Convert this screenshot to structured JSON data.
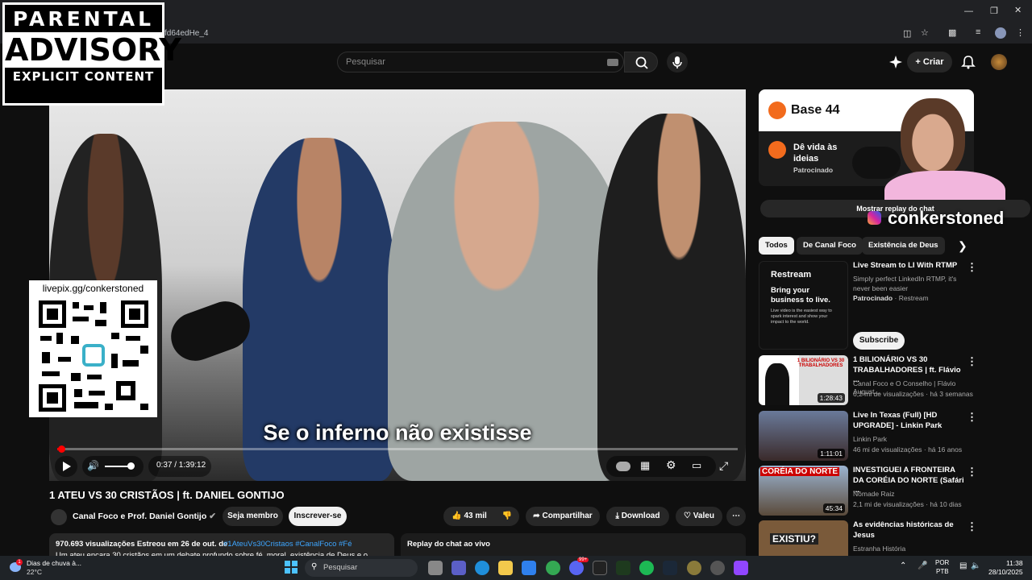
{
  "browser": {
    "url_fragment": "fd64edHe_4",
    "window_controls": [
      "minimize-icon",
      "restore-icon",
      "close-icon"
    ]
  },
  "youtube": {
    "search_placeholder": "Pesquisar",
    "create_label": "Criar",
    "video": {
      "subtitle": "Se o inferno não existisse",
      "time": "0:37 / 1:39:12",
      "progress_fraction": 0.006,
      "title": "1 ATEU VS 30 CRISTÃOS | ft. DANIEL GONTIJO",
      "channel": "Canal Foco e Prof. Daniel Gontijo",
      "member_label": "Seja membro",
      "subscribe_label": "Inscrever-se",
      "likes": "43 mil",
      "share_label": "Compartilhar",
      "download_label": "Download",
      "thanks_label": "Valeu",
      "views": "970.693 visualizações  Estreou em 26 de out. de",
      "tags": "#1AteuVs30Cristaos #CanalFoco #Fé",
      "description_line": "Um ateu encara 30 cristãos em um debate profundo sobre fé, moral, existência de Deus e o...",
      "replay_chat": "Replay do chat ao vivo"
    },
    "sidebar_ad": {
      "brand": "Base 44",
      "line1": "Dê vida às",
      "line2": "ideias",
      "sponsored": "Patrocinado"
    },
    "show_chat": "Mostrar replay do chat",
    "chips": [
      "Todos",
      "De Canal Foco",
      "Existência de Deus"
    ],
    "ad2": {
      "title": "Live Stream to LI With RTMP",
      "desc": "Simply perfect LinkedIn RTMP, it's never been easier",
      "sponsor": "Patrocinado",
      "advertiser": "Restream",
      "subscribe": "Subscribe",
      "thumb_brand": "Restream",
      "thumb_headline": "Bring your business to live.",
      "thumb_body": "Live video is the easiest way to spark interest and show your impact to the world."
    },
    "recommendations": [
      {
        "title": "1 BILIONÁRIO VS 30 TRABALHADORES | ft. Flávio ...",
        "channel": "Canal Foco e O Conselho | Flávio August...",
        "meta": "6,2 mi de visualizações · há 3 semanas",
        "duration": "1:28:43",
        "thumb_text": "1 BILIONÁRIO VS 30 TRABALHADORES"
      },
      {
        "title": "Live In Texas (Full) [HD UPGRADE] - Linkin Park",
        "channel": "Linkin Park",
        "meta": "46 mi de visualizações · há 16 anos",
        "duration": "1:11:01",
        "thumb_text": ""
      },
      {
        "title": "INVESTIGUEI A FRONTEIRA DA CORÉIA DO NORTE (Safári ...",
        "channel": "Nômade Raiz",
        "meta": "2,1 mi de visualizações · há 10 dias",
        "duration": "45:34",
        "thumb_text": "CORÉIA DO NORTE"
      },
      {
        "title": "As evidências históricas de Jesus",
        "channel": "Estranha História",
        "meta": "",
        "duration": "",
        "thumb_text": "EXISTIU?"
      }
    ]
  },
  "overlays": {
    "advisory_line1": "PARENTAL",
    "advisory_line2": "ADVISORY",
    "advisory_line3": "EXPLICIT CONTENT",
    "qr_label": "livepix.gg/conkerstoned",
    "streamer_handle": "conkerstoned"
  },
  "taskbar": {
    "weather_title": "Dias de chuva à...",
    "weather_temp": "22°C",
    "search_placeholder": "Pesquisar",
    "lang": "POR",
    "layout": "PTB",
    "time": "11:38",
    "date": "28/10/2025",
    "badge_discord": "99+"
  },
  "colors": {
    "accent_red": "#ff0000",
    "yt_bg": "#0f0f0f",
    "chip_bg": "#272727",
    "base44_orange": "#f26b1d"
  }
}
